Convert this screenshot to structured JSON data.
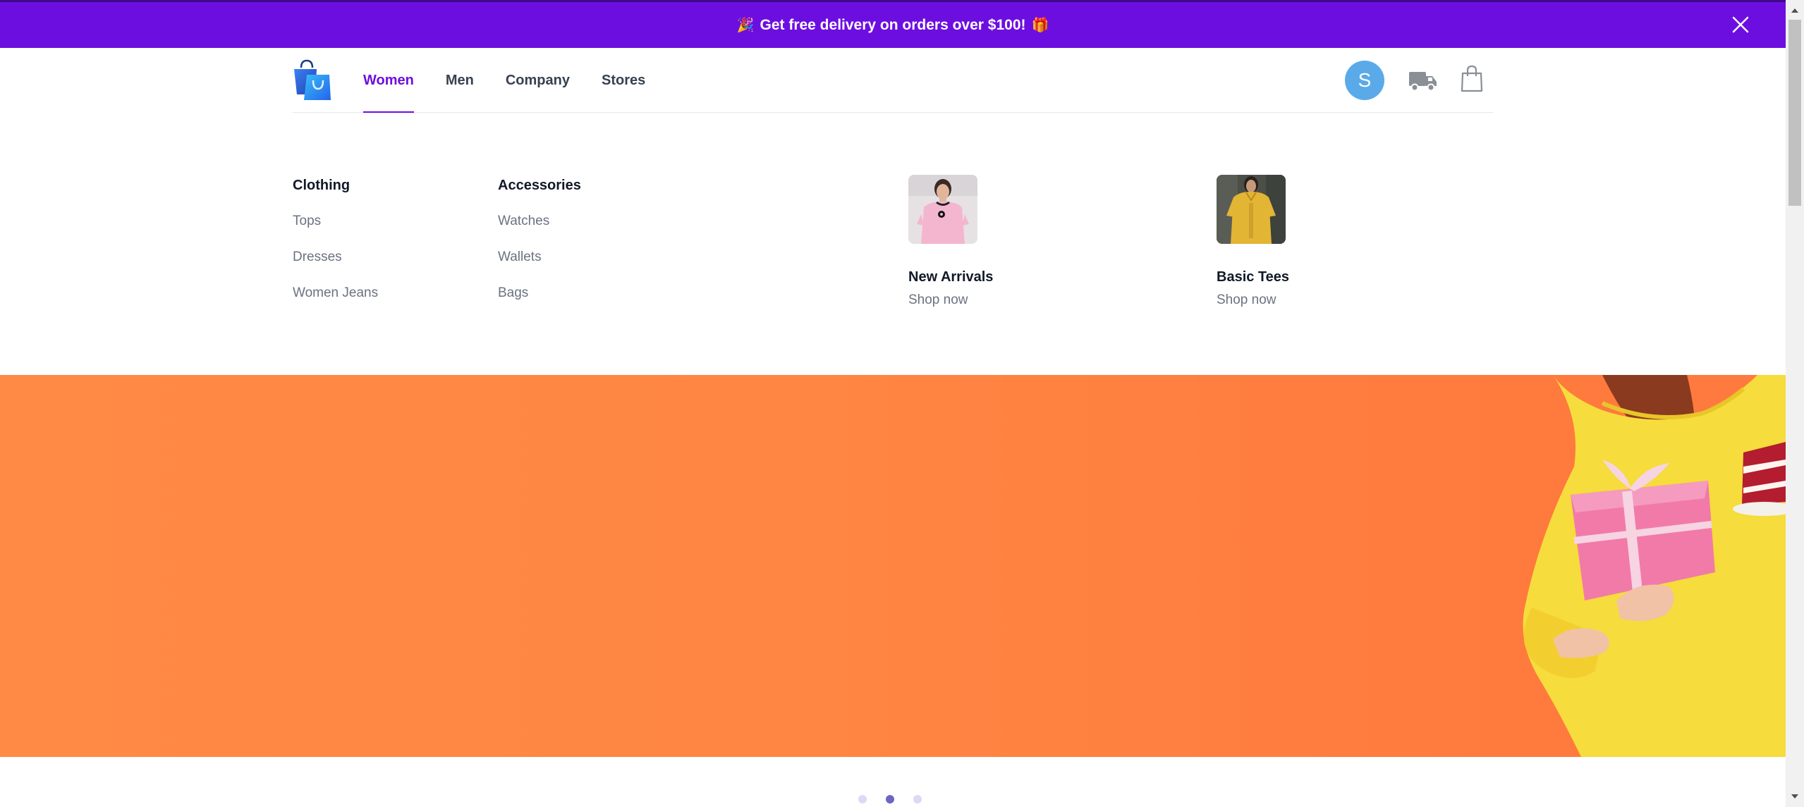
{
  "announcement": {
    "left_emoji": "🎉",
    "text": "Get free delivery on orders over $100!",
    "right_emoji": "🎁"
  },
  "header": {
    "nav": [
      "Women",
      "Men",
      "Company",
      "Stores"
    ],
    "active_nav": "Women",
    "avatar_initial": "S"
  },
  "mega_menu": {
    "clothing": {
      "title": "Clothing",
      "links": [
        "Tops",
        "Dresses",
        "Women Jeans"
      ]
    },
    "accessories": {
      "title": "Accessories",
      "links": [
        "Watches",
        "Wallets",
        "Bags"
      ]
    },
    "features": [
      {
        "title": "New Arrivals",
        "cta": "Shop now"
      },
      {
        "title": "Basic Tees",
        "cta": "Shop now"
      }
    ]
  },
  "carousel": {
    "slide_count": 3,
    "active_index": 1
  },
  "colors": {
    "brand": "#6d0ee0",
    "hero_bg": "#ff8643",
    "avatar_bg": "#5aaae9"
  }
}
